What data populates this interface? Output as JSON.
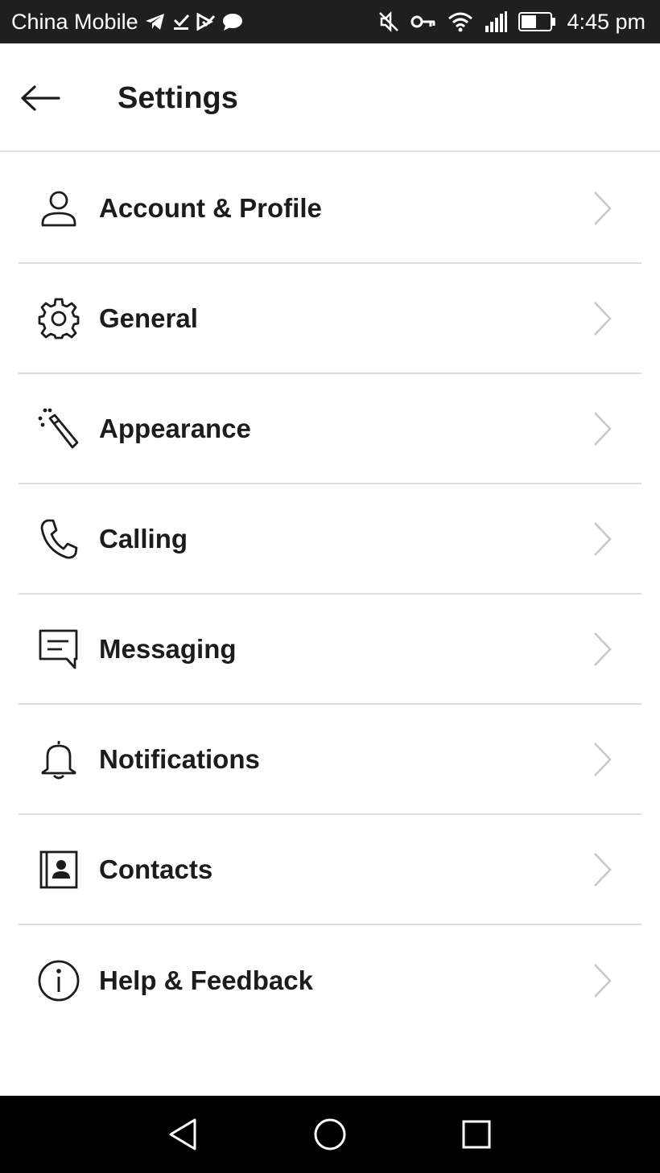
{
  "status_bar": {
    "carrier": "China Mobile",
    "time": "4:45 pm",
    "left_icons": [
      "telegram-icon",
      "download-done-icon",
      "task-check-icon",
      "chat-bubble-icon"
    ],
    "right_icons": [
      "mute-icon",
      "vpn-key-icon",
      "wifi-icon",
      "signal-icon",
      "battery-icon"
    ]
  },
  "header": {
    "title": "Settings",
    "back_icon": "arrow-left-icon"
  },
  "settings": {
    "items": [
      {
        "label": "Account & Profile",
        "icon": "person-icon"
      },
      {
        "label": "General",
        "icon": "gear-icon"
      },
      {
        "label": "Appearance",
        "icon": "magic-wand-icon"
      },
      {
        "label": "Calling",
        "icon": "phone-icon"
      },
      {
        "label": "Messaging",
        "icon": "message-icon"
      },
      {
        "label": "Notifications",
        "icon": "bell-icon"
      },
      {
        "label": "Contacts",
        "icon": "contact-card-icon"
      },
      {
        "label": "Help & Feedback",
        "icon": "info-icon"
      }
    ],
    "chevron_icon": "chevron-right-icon"
  },
  "nav_bar": {
    "buttons": [
      "back-triangle-icon",
      "home-circle-icon",
      "recents-square-icon"
    ]
  },
  "colors": {
    "status_bar_bg": "#1f1f1f",
    "text": "#1c1c1c",
    "divider": "#dcdcdc",
    "chevron": "#c8c8c8",
    "nav_bar_bg": "#000000"
  }
}
